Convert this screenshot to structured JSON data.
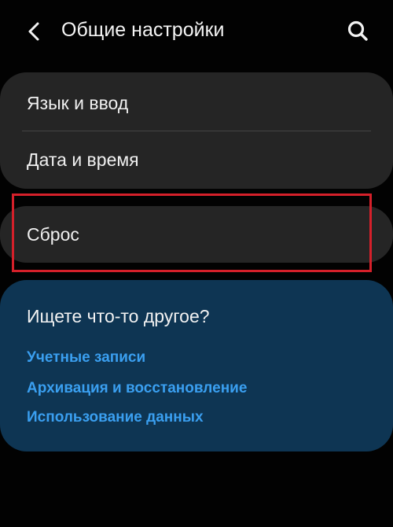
{
  "header": {
    "title": "Общие настройки",
    "back_icon": "chevron-left-icon",
    "search_icon": "search-icon"
  },
  "settings": {
    "items": [
      {
        "label": "Язык и ввод"
      },
      {
        "label": "Дата и время"
      },
      {
        "label": "Сброс"
      }
    ]
  },
  "suggestions": {
    "title": "Ищете что-то другое?",
    "links": [
      {
        "label": "Учетные записи"
      },
      {
        "label": "Архивация и восстановление"
      },
      {
        "label": "Использование данных"
      }
    ]
  },
  "colors": {
    "background": "#020202",
    "card": "#252525",
    "suggestion_card": "#0e3553",
    "link": "#3a9ff0",
    "highlight_border": "#d5202a"
  }
}
